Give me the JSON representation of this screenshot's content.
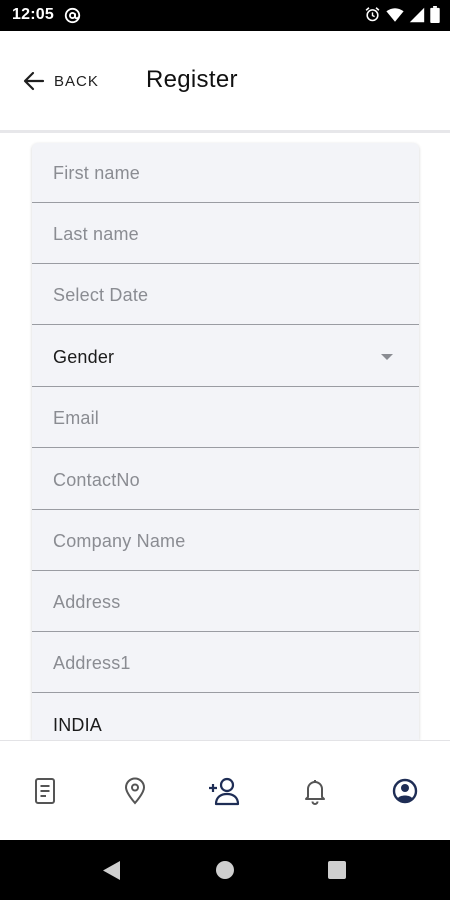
{
  "status_bar": {
    "time": "12:05",
    "app_icon": "at-sign-icon",
    "icons": [
      "alarm-icon",
      "wifi-icon",
      "signal-icon",
      "battery-icon"
    ]
  },
  "header": {
    "back_label": "BACK",
    "title": "Register"
  },
  "form": {
    "fields": [
      {
        "name": "first-name",
        "placeholder": "First name"
      },
      {
        "name": "last-name",
        "placeholder": "Last name"
      },
      {
        "name": "date",
        "placeholder": "Select Date"
      },
      {
        "name": "gender",
        "value": "Gender",
        "type": "dropdown"
      },
      {
        "name": "email",
        "placeholder": "Email"
      },
      {
        "name": "contact-no",
        "placeholder": "ContactNo"
      },
      {
        "name": "company-name",
        "placeholder": "Company Name"
      },
      {
        "name": "address",
        "placeholder": "Address"
      },
      {
        "name": "address1",
        "placeholder": "Address1"
      },
      {
        "name": "country",
        "value": "INDIA"
      }
    ]
  },
  "bottom_nav": {
    "items": [
      {
        "icon": "document-icon",
        "active": false
      },
      {
        "icon": "location-pin-icon",
        "active": false
      },
      {
        "icon": "add-user-icon",
        "active": true
      },
      {
        "icon": "bell-icon",
        "active": false
      },
      {
        "icon": "account-circle-icon",
        "active": true
      }
    ],
    "active_color": "#1e2d55",
    "inactive_color": "#555555"
  },
  "system_nav": {
    "icons": [
      "back-triangle-icon",
      "home-circle-icon",
      "recents-square-icon"
    ]
  }
}
